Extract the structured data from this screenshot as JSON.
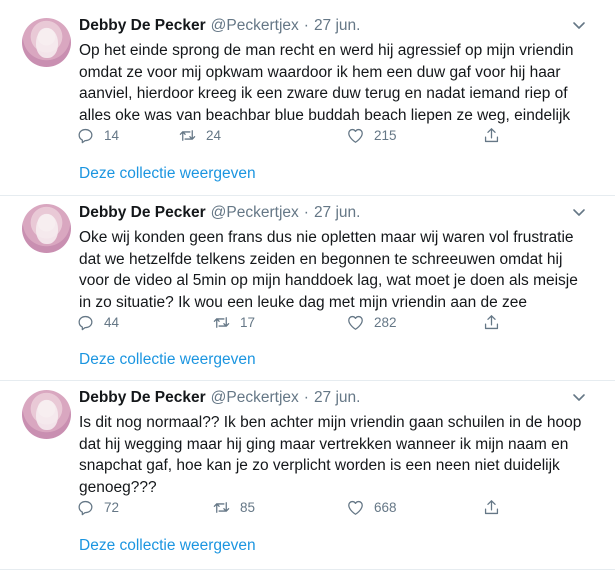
{
  "tweets": [
    {
      "author_name": "Debby De Pecker",
      "author_handle": "@Peckertjex",
      "separator": "·",
      "date": "27 jun.",
      "lines": [
        "Op het einde sprong de man recht en werd hij agressief op mijn vriendin",
        "omdat ze voor mij opkwam waardoor ik hem een duw gaf voor hij haar",
        "aanviel, hierdoor kreeg ik een zware duw terug en nadat iemand riep of",
        "alles oke was van beachbar blue buddah beach liepen ze weg, eindelijk"
      ],
      "replies": "14",
      "retweets": "24",
      "likes": "215",
      "collection_link": "Deze collectie weergeven"
    },
    {
      "author_name": "Debby De Pecker",
      "author_handle": "@Peckertjex",
      "separator": "·",
      "date": "27 jun.",
      "lines": [
        "Oke wij konden geen frans dus nie opletten maar wij waren vol frustratie",
        "dat we hetzelfde telkens zeiden en begonnen te schreeuwen omdat hij",
        "voor de video al 5min op mijn handdoek lag, wat moet je doen als meisje",
        "in zo situatie? Ik wou een leuke dag met mijn vriendin aan de zee"
      ],
      "replies": "44",
      "retweets": "17",
      "likes": "282",
      "collection_link": "Deze collectie weergeven"
    },
    {
      "author_name": "Debby De Pecker",
      "author_handle": "@Peckertjex",
      "separator": "·",
      "date": "27 jun.",
      "lines": [
        "Is dit nog normaal?? Ik ben achter mijn vriendin gaan schuilen in de hoop",
        "dat hij wegging maar hij ging maar vertrekken wanneer ik mijn naam en",
        "snapchat gaf, hoe kan je zo verplicht worden is een neen niet duidelijk",
        "genoeg???"
      ],
      "replies": "72",
      "retweets": "85",
      "likes": "668",
      "collection_link": "Deze collectie weergeven"
    }
  ],
  "colors": {
    "text": "#14171a",
    "muted": "#657786",
    "link": "#1b95e0",
    "divider": "#e6ecf0"
  },
  "icons": [
    "reply-icon",
    "retweet-icon",
    "like-icon",
    "share-icon",
    "chevron-down-icon"
  ]
}
